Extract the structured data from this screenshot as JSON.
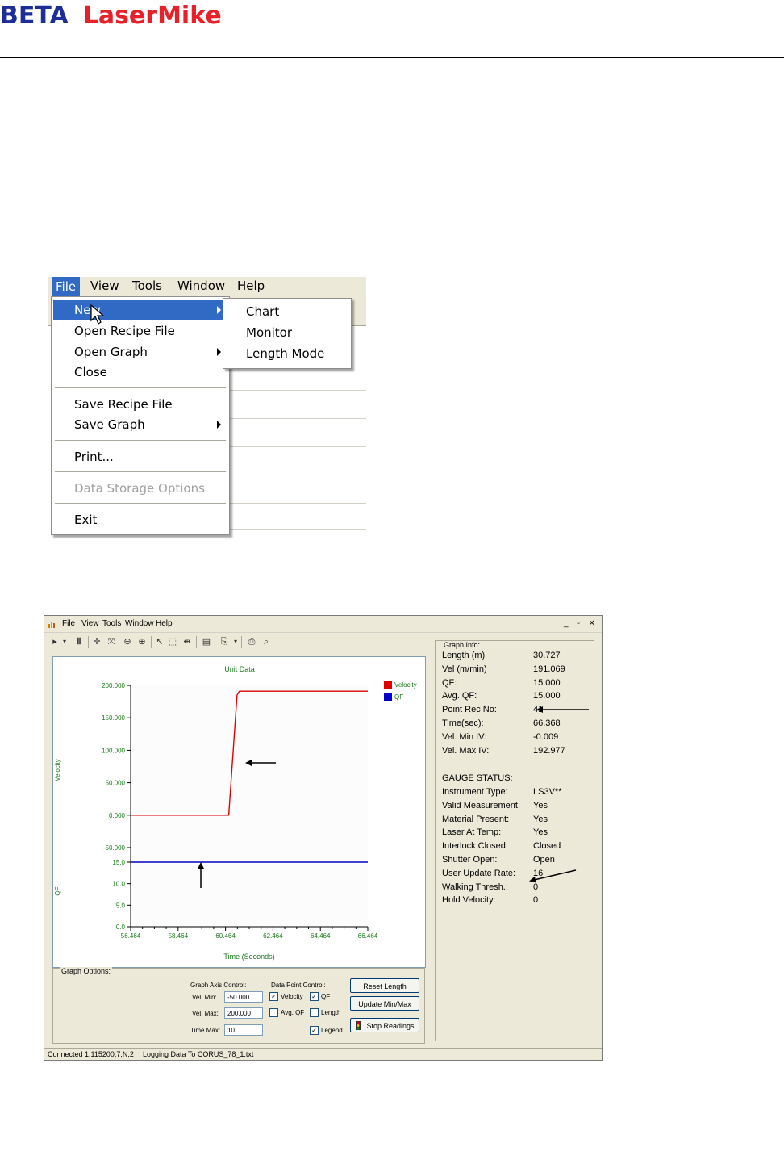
{
  "header": {
    "brand_beta": "BETA",
    "brand_lasermike": "LaserMike"
  },
  "menu_screenshot": {
    "menubar": [
      "File",
      "View",
      "Tools",
      "Window",
      "Help"
    ],
    "file_menu": [
      {
        "label": "New",
        "submenu": true,
        "highlighted": true
      },
      {
        "label": "Open Recipe File"
      },
      {
        "label": "Open Graph",
        "submenu": true
      },
      {
        "label": "Close"
      },
      {
        "label": "Save Recipe File"
      },
      {
        "label": "Save Graph",
        "submenu": true
      },
      {
        "label": "Print..."
      },
      {
        "label": "Data Storage Options",
        "disabled": true
      },
      {
        "label": "Exit"
      }
    ],
    "new_submenu": [
      "Chart",
      "Monitor",
      "Length Mode"
    ]
  },
  "app_window": {
    "menubar": [
      "File",
      "View",
      "Tools",
      "Window",
      "Help"
    ],
    "window_buttons": "_ ▫ ✕",
    "graph_info": {
      "title": "Graph Info:",
      "rows": [
        {
          "label": "Length (m)",
          "value": "30.727"
        },
        {
          "label": "Vel (m/min)",
          "value": "191.069"
        },
        {
          "label": "QF:",
          "value": "15.000"
        },
        {
          "label": "Avg. QF:",
          "value": "15.000"
        },
        {
          "label": "Point Rec No:",
          "value": "41"
        },
        {
          "label": "Time(sec):",
          "value": "66.368"
        },
        {
          "label": "Vel. Min IV:",
          "value": "-0.009"
        },
        {
          "label": "Vel. Max IV:",
          "value": "192.977"
        }
      ],
      "gauge_title": "GAUGE STATUS:",
      "gauge_rows": [
        {
          "label": "Instrument Type:",
          "value": "LS3V**"
        },
        {
          "label": "Valid Measurement:",
          "value": "Yes"
        },
        {
          "label": "Material Present:",
          "value": "Yes"
        },
        {
          "label": "Laser At Temp:",
          "value": "Yes"
        },
        {
          "label": "Interlock Closed:",
          "value": "Closed"
        },
        {
          "label": "Shutter Open:",
          "value": "Open"
        },
        {
          "label": "User Update Rate:",
          "value": "16"
        },
        {
          "label": "Walking Thresh.:",
          "value": "0"
        },
        {
          "label": "Hold Velocity:",
          "value": "0"
        }
      ]
    },
    "graph_options": {
      "title": "Graph Options:",
      "axis_control_title": "Graph Axis Control:",
      "vel_min_label": "Vel. Min:",
      "vel_min": "-50.000",
      "vel_max_label": "Vel. Max:",
      "vel_max": "200.000",
      "time_max_label": "Time Max:",
      "time_max": "10",
      "data_point_title": "Data Point Control:",
      "cb_velocity": "Velocity",
      "cb_qf": "QF",
      "cb_avgqf": "Avg. QF",
      "cb_length": "Length",
      "cb_legend": "Legend",
      "btn_reset": "Reset Length",
      "btn_update": "Update Min/Max",
      "btn_stop": "Stop Readings"
    },
    "status": {
      "conn": "Connected 1,115200,7,N,2",
      "log": "Logging Data To CORUS_78_1.txt"
    }
  },
  "colors": {
    "velocity": "#e00000",
    "qf": "#0000c8",
    "axis_text": "#1a7a1a"
  },
  "chart_data": {
    "type": "line",
    "title": "Unit Data",
    "xlabel": "Time (Seconds)",
    "x_ticks": [
      "56.464",
      "58.464",
      "60.464",
      "62.464",
      "64.464",
      "66.464"
    ],
    "xlim": [
      56.464,
      66.464
    ],
    "legend": [
      "Velocity",
      "QF"
    ],
    "velocity_panel": {
      "ylabel": "Velocity",
      "y_ticks": [
        "200.000",
        "150.000",
        "100.000",
        "50.000",
        "0.000",
        "-50.000"
      ],
      "ylim": [
        -50,
        200
      ],
      "series": {
        "name": "Velocity",
        "x": [
          56.464,
          59.1,
          60.6,
          60.95,
          61.05,
          66.464
        ],
        "values": [
          0,
          0,
          0,
          185,
          191,
          191
        ]
      }
    },
    "qf_panel": {
      "ylabel": "QF",
      "y_ticks": [
        "15.0",
        "10.0",
        "5.0",
        "0.0"
      ],
      "ylim": [
        0,
        15
      ],
      "series": {
        "name": "QF",
        "x": [
          56.464,
          66.464
        ],
        "values": [
          15,
          15
        ]
      }
    }
  }
}
